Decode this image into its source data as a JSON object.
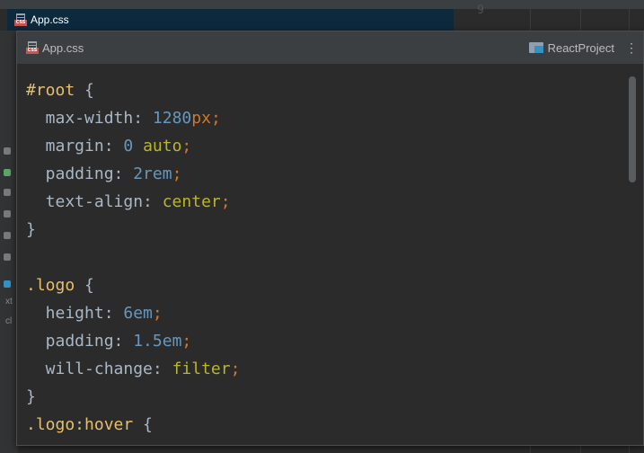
{
  "background": {
    "tab_title": "App.css",
    "line_number": "9",
    "left_strip_texts": [
      "xt",
      "cl"
    ]
  },
  "popup": {
    "title": "App.css",
    "project_name": "ReactProject",
    "more_label": "⋮"
  },
  "code_lines": [
    [
      {
        "t": "#root",
        "c": "sel"
      },
      {
        "t": " {",
        "c": "brace"
      }
    ],
    [
      {
        "t": "  max-width: ",
        "c": "prop"
      },
      {
        "t": "1280",
        "c": "num"
      },
      {
        "t": "px",
        "c": "unit"
      },
      {
        "t": ";",
        "c": "semi"
      }
    ],
    [
      {
        "t": "  margin: ",
        "c": "prop"
      },
      {
        "t": "0",
        "c": "num"
      },
      {
        "t": " ",
        "c": "prop"
      },
      {
        "t": "auto",
        "c": "kw"
      },
      {
        "t": ";",
        "c": "semi"
      }
    ],
    [
      {
        "t": "  padding: ",
        "c": "prop"
      },
      {
        "t": "2rem",
        "c": "num"
      },
      {
        "t": ";",
        "c": "semi"
      }
    ],
    [
      {
        "t": "  text-align: ",
        "c": "prop"
      },
      {
        "t": "center",
        "c": "kw"
      },
      {
        "t": ";",
        "c": "semi"
      }
    ],
    [
      {
        "t": "}",
        "c": "brace"
      }
    ],
    [],
    [
      {
        "t": ".logo",
        "c": "sel"
      },
      {
        "t": " {",
        "c": "brace"
      }
    ],
    [
      {
        "t": "  height: ",
        "c": "prop"
      },
      {
        "t": "6em",
        "c": "num"
      },
      {
        "t": ";",
        "c": "semi"
      }
    ],
    [
      {
        "t": "  padding: ",
        "c": "prop"
      },
      {
        "t": "1.5em",
        "c": "num"
      },
      {
        "t": ";",
        "c": "semi"
      }
    ],
    [
      {
        "t": "  will-change: ",
        "c": "prop"
      },
      {
        "t": "filter",
        "c": "kw"
      },
      {
        "t": ";",
        "c": "semi"
      }
    ],
    [
      {
        "t": "}",
        "c": "brace"
      }
    ],
    [
      {
        "t": ".logo:hover",
        "c": "sel"
      },
      {
        "t": " {",
        "c": "brace"
      }
    ]
  ]
}
